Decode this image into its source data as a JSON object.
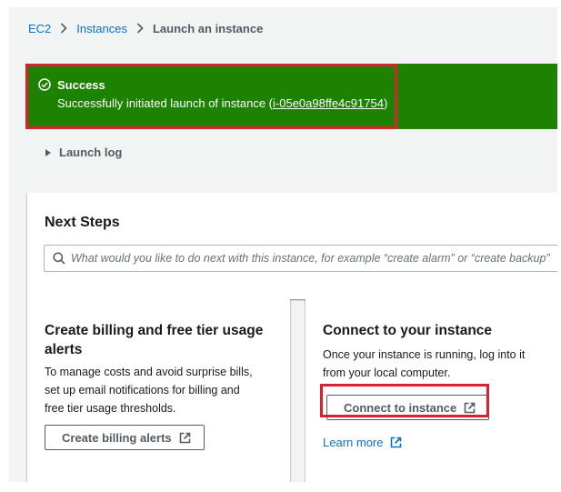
{
  "breadcrumb": {
    "items": [
      "EC2",
      "Instances"
    ],
    "current": "Launch an instance"
  },
  "flash": {
    "type": "success",
    "title": "Success",
    "message_prefix": "Successfully initiated launch of instance (",
    "instance_id": "i-05e0a98ffe4c91754",
    "message_suffix": ")",
    "color": "#1d8102"
  },
  "launch_log": {
    "label": "Launch log"
  },
  "next_steps": {
    "title": "Next Steps",
    "search_placeholder": "What would you like to do next with this instance, for example “create alarm” or “create backup”"
  },
  "billing_card": {
    "title": "Create billing and free tier usage alerts",
    "title_lines": [
      "Create billing and free tier usage",
      "alerts"
    ],
    "body_lines": [
      "To manage costs and avoid surprise bills,",
      "set up email notifications for billing and",
      "free tier usage thresholds."
    ],
    "button_label": "Create billing alerts"
  },
  "connect_card": {
    "title": "Connect to your instance",
    "body_lines": [
      "Once your instance is running, log into it",
      "from your local computer."
    ],
    "button_label": "Connect to instance",
    "learn_more_label": "Learn more"
  },
  "annotations": {
    "highlight_color": "#d8232f"
  },
  "colors": {
    "link": "#0972d3",
    "success": "#1d8102",
    "page_bg": "#f2f3f3"
  }
}
